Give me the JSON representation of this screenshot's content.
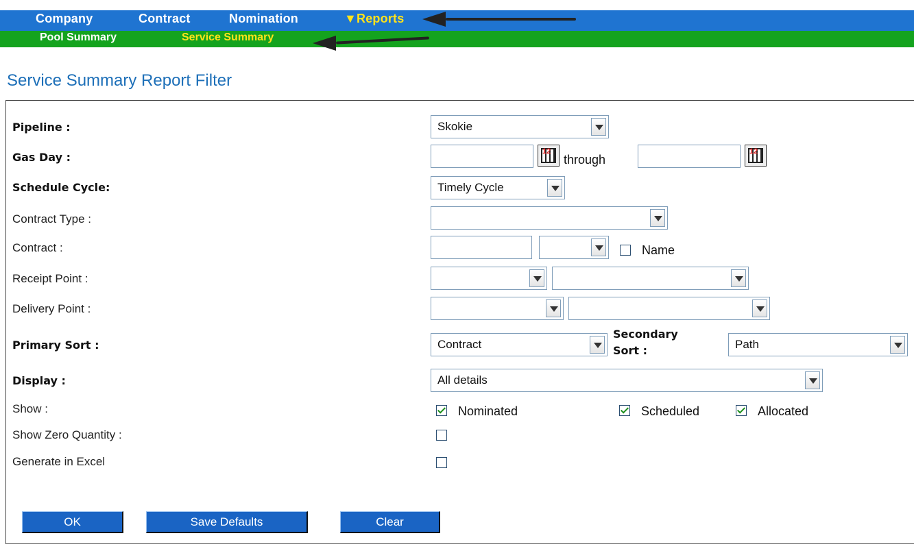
{
  "menu": {
    "top": [
      "Company",
      "Contract",
      "Nomination",
      "▼Reports"
    ],
    "sub": [
      "Pool Summary",
      "Service Summary"
    ]
  },
  "page": {
    "title": "Service Summary Report Filter"
  },
  "form": {
    "pipeline": {
      "label": "Pipeline :",
      "value": "Skokie"
    },
    "gas_day": {
      "label": "Gas Day :",
      "from": "",
      "through_label": "through",
      "to": ""
    },
    "schedule_cycle": {
      "label": "Schedule Cycle:",
      "value": "Timely Cycle"
    },
    "contract_type": {
      "label": "Contract Type :",
      "value": ""
    },
    "contract": {
      "label": "Contract :",
      "value": "",
      "select": "",
      "name_label": "Name",
      "name_checked": false
    },
    "receipt_point": {
      "label": "Receipt Point :",
      "code": "",
      "name": ""
    },
    "delivery_point": {
      "label": "Delivery Point :",
      "code": "",
      "name": ""
    },
    "primary_sort": {
      "label": "Primary Sort :",
      "value": "Contract"
    },
    "secondary_sort": {
      "label_line1": "Secondary",
      "label_line2": "Sort :",
      "value": "Path"
    },
    "display": {
      "label": "Display :",
      "value": "All details"
    },
    "show": {
      "label": "Show :",
      "options": [
        {
          "label": "Nominated",
          "checked": true
        },
        {
          "label": "Scheduled",
          "checked": true
        },
        {
          "label": "Allocated",
          "checked": true
        }
      ]
    },
    "show_zero": {
      "label": "Show Zero Quantity :",
      "checked": false
    },
    "generate_excel": {
      "label": "Generate in Excel",
      "checked": false
    }
  },
  "buttons": {
    "ok": "OK",
    "save_defaults": "Save Defaults",
    "clear": "Clear"
  },
  "colors": {
    "menu_bg": "#1f74d1",
    "submenu_bg": "#14a31e",
    "active_text": "#ffe21a",
    "title": "#1d6fb8",
    "button_bg": "#1a64c4"
  },
  "icons": {
    "calendar": "calendar-icon",
    "dropdown": "chevron-down-icon",
    "annotation": "arrow-icon"
  }
}
